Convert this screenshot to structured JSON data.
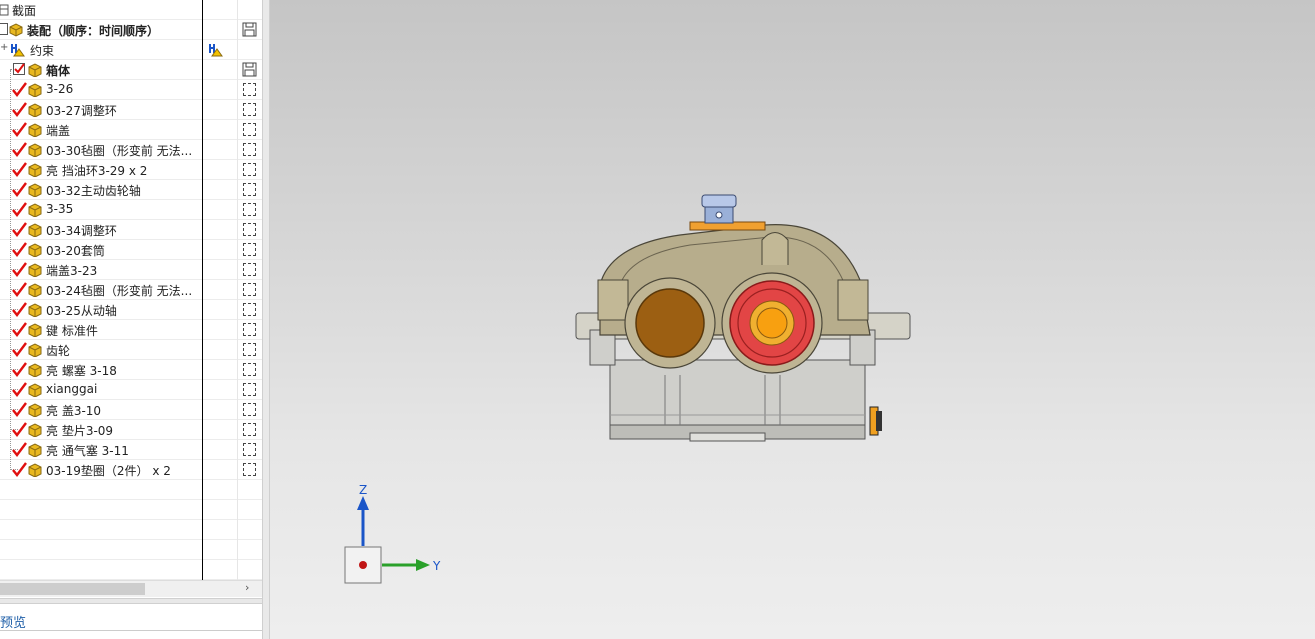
{
  "tree": {
    "root_label": "截面",
    "assembly_label": "装配（顺序：时间顺序）",
    "constraints_label": "约束",
    "items": [
      {
        "label": "箱体",
        "kind": "top"
      },
      {
        "label": "3-26"
      },
      {
        "label": "03-27调整环"
      },
      {
        "label": "端盖"
      },
      {
        "label": "03-30毡圈（形变前 无法..."
      },
      {
        "label": "亮 挡油环3-29 x 2"
      },
      {
        "label": "03-32主动齿轮轴"
      },
      {
        "label": "3-35"
      },
      {
        "label": "03-34调整环"
      },
      {
        "label": "03-20套筒"
      },
      {
        "label": "端盖3-23"
      },
      {
        "label": "03-24毡圈（形变前 无法..."
      },
      {
        "label": "03-25从动轴"
      },
      {
        "label": "键 标准件"
      },
      {
        "label": "齿轮"
      },
      {
        "label": "亮 螺塞 3-18"
      },
      {
        "label": "xianggai"
      },
      {
        "label": "亮 盖3-10"
      },
      {
        "label": "亮 垫片3-09"
      },
      {
        "label": "亮 通气塞 3-11"
      },
      {
        "label": "03-19垫圈（2件） x 2"
      }
    ]
  },
  "scroll_right_glyph": "›",
  "preview_label": "预览",
  "triad": {
    "z_label": "Z",
    "y_label": "Y"
  },
  "colors": {
    "check_red": "#e01010",
    "box_yellow": "#e8b820",
    "axis_blue": "#1a55c8",
    "axis_green": "#2aa02a"
  }
}
